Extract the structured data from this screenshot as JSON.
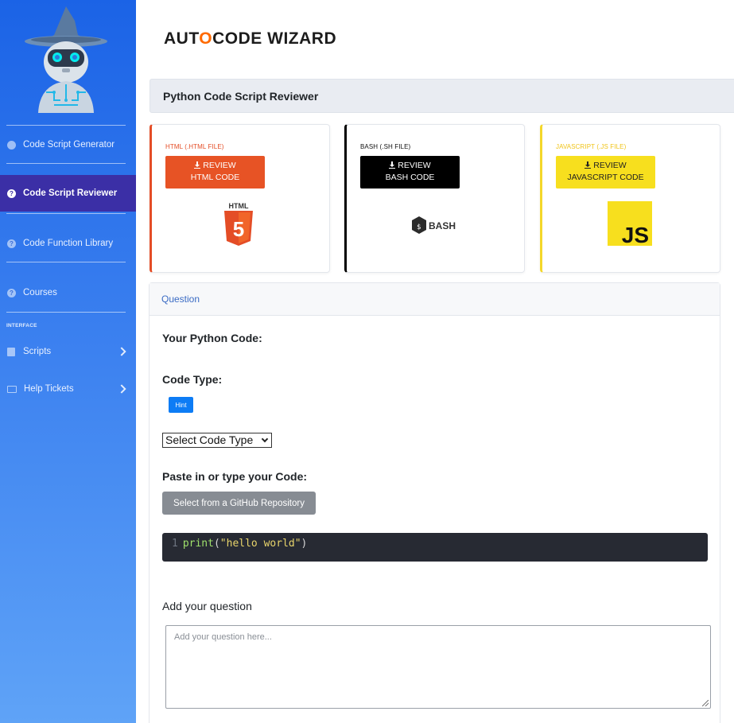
{
  "brand": {
    "pre": "AUT",
    "o": "O",
    "post": "CODE WIZARD"
  },
  "sidebar": {
    "section_heading": "INTERFACE",
    "items": [
      {
        "label": "Code Script Generator"
      },
      {
        "label": "Code Script Reviewer"
      },
      {
        "label": "Code Function Library"
      },
      {
        "label": "Courses"
      },
      {
        "label": "Scripts"
      },
      {
        "label": "Help Tickets"
      }
    ]
  },
  "page": {
    "title": "Python Code Script Reviewer"
  },
  "cards": [
    {
      "file_label": "HTML (.HTML FILE)",
      "button_line1": "REVIEW",
      "button_line2": "HTML CODE",
      "icon_text": "HTML",
      "icon_number": "5",
      "accent": "#e44d26"
    },
    {
      "file_label": "BASH (.SH FILE)",
      "button_line1": "REVIEW",
      "button_line2": "BASH CODE",
      "icon_text": "BASH",
      "accent": "#000000"
    },
    {
      "file_label": "JAVASCRIPT (.JS FILE)",
      "button_line1": "REVIEW",
      "button_line2": "JAVASCRIPT CODE",
      "icon_text": "JS",
      "accent": "#f7df1e"
    }
  ],
  "question_panel": {
    "header": "Question",
    "your_code_label": "Your Python Code:",
    "code_type_label": "Code Type:",
    "hint_button": "Hint",
    "code_type_select": "Select Code Type",
    "paste_label": "Paste in or type your Code:",
    "github_button": "Select from a GitHub Repository",
    "editor": {
      "line_number": "1",
      "code_fn": "print",
      "code_open": "(",
      "code_string": "\"hello world\"",
      "code_close": ")"
    },
    "question_label": "Add your question",
    "question_placeholder": "Add your question here..."
  },
  "colors": {
    "sidebar_top": "#1b63e6",
    "sidebar_active": "#3b2fa6",
    "brand_accent": "#ff6a00",
    "hint_blue": "#0d7cf5"
  }
}
